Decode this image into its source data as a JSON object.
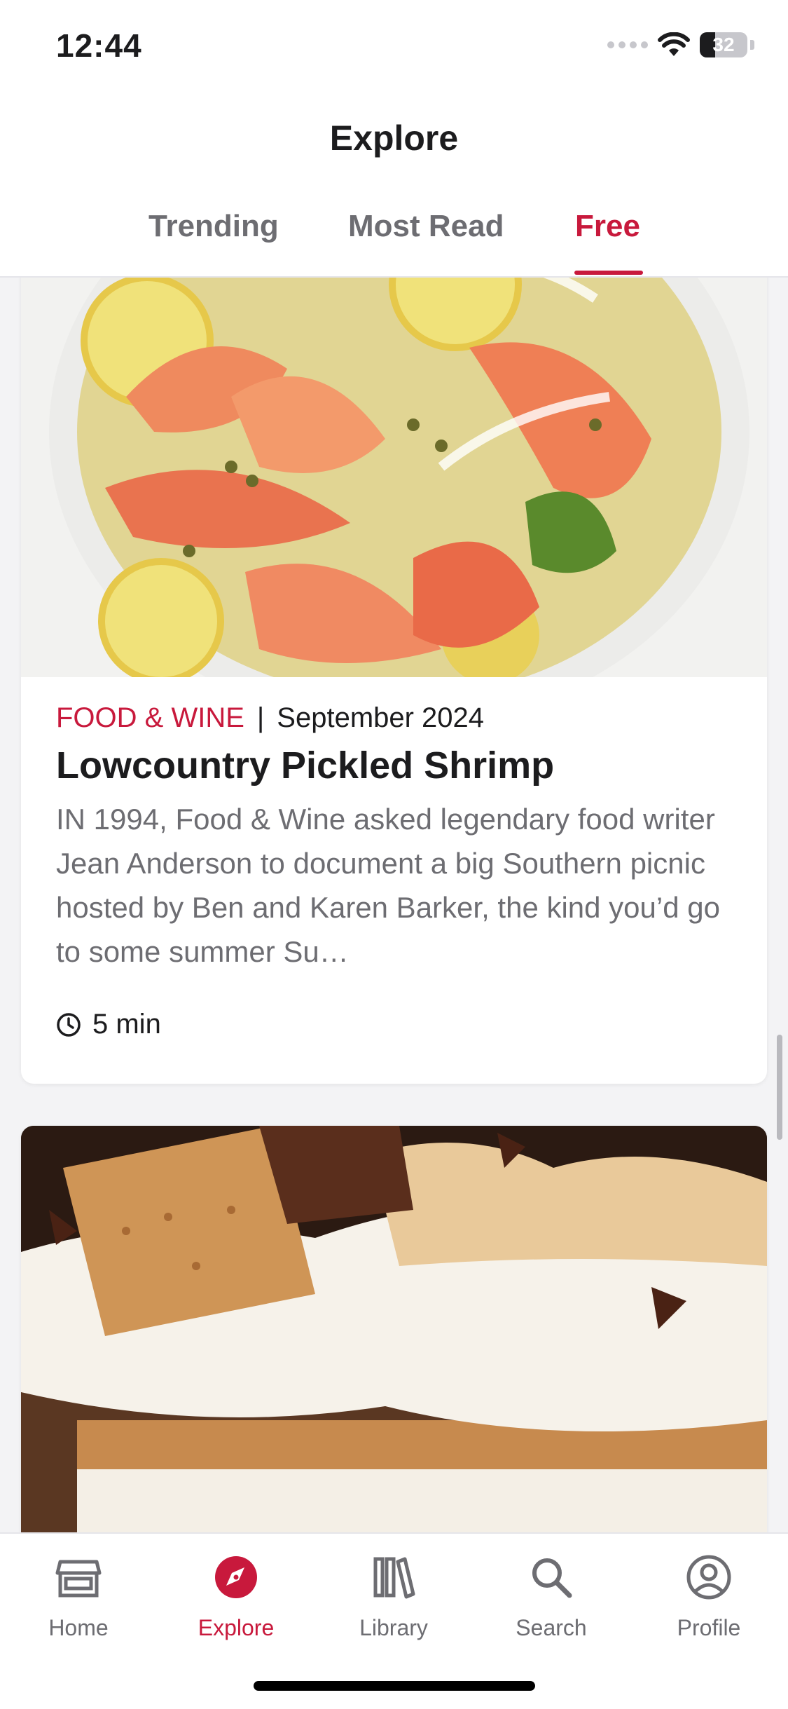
{
  "status_bar": {
    "time": "12:44",
    "battery": "32"
  },
  "header": {
    "title": "Explore"
  },
  "tabs": [
    {
      "label": "Trending",
      "active": false
    },
    {
      "label": "Most Read",
      "active": false
    },
    {
      "label": "Free",
      "active": true
    }
  ],
  "articles": [
    {
      "publisher": "FOOD & WINE",
      "separator": "|",
      "issue": "September 2024",
      "title": "Lowcountry Pickled Shrimp",
      "excerpt": "IN 1994, Food & Wine asked legendary food writer Jean Anderson to document a big Southern picnic hosted by Ben and Karen Barker, the kind you’d go to some summer Su…",
      "read_time": "5 min",
      "image": "pickled-shrimp-plate-photo"
    },
    {
      "image": "smores-icebox-cake-photo"
    }
  ],
  "bottom_nav": [
    {
      "label": "Home",
      "icon": "store-icon"
    },
    {
      "label": "Explore",
      "icon": "compass-icon",
      "active": true
    },
    {
      "label": "Library",
      "icon": "library-icon"
    },
    {
      "label": "Search",
      "icon": "search-icon"
    },
    {
      "label": "Profile",
      "icon": "profile-icon"
    }
  ],
  "colors": {
    "accent": "#c8193c",
    "muted": "#6d6d72",
    "text": "#1c1c1e"
  }
}
